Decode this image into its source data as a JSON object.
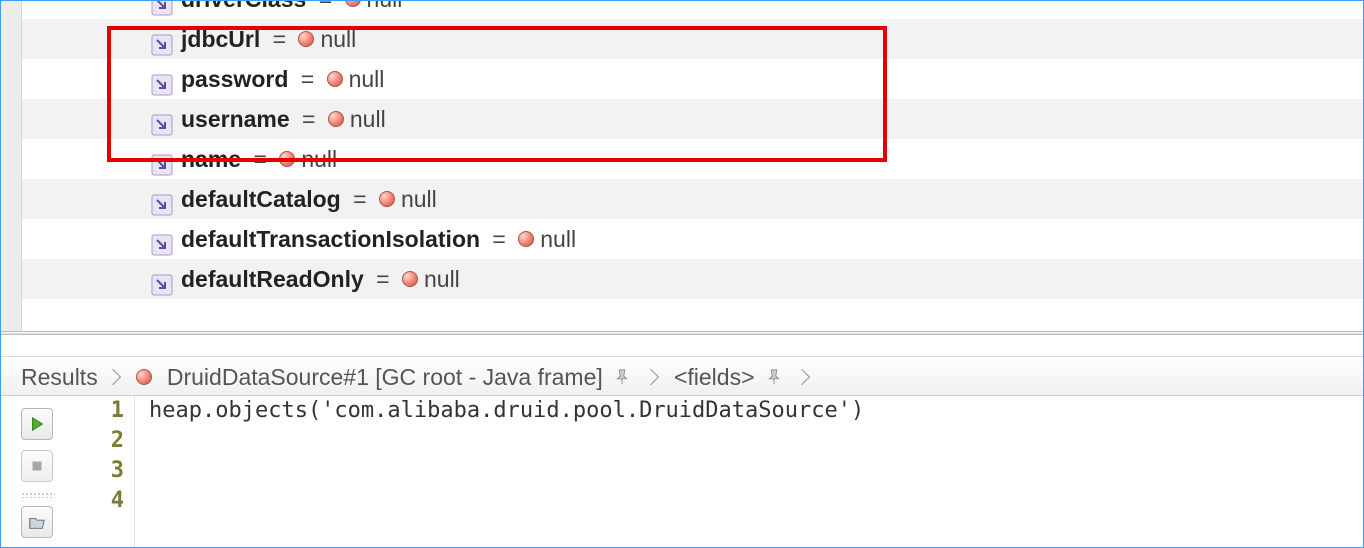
{
  "fields": [
    {
      "name": "driverClass",
      "value": "null",
      "alt": false
    },
    {
      "name": "jdbcUrl",
      "value": "null",
      "alt": true
    },
    {
      "name": "password",
      "value": "null",
      "alt": false
    },
    {
      "name": "username",
      "value": "null",
      "alt": true
    },
    {
      "name": "name",
      "value": "null",
      "alt": false
    },
    {
      "name": "defaultCatalog",
      "value": "null",
      "alt": true
    },
    {
      "name": "defaultTransactionIsolation",
      "value": "null",
      "alt": false
    },
    {
      "name": "defaultReadOnly",
      "value": "null",
      "alt": true
    }
  ],
  "highlightedFields": [
    "jdbcUrl",
    "password",
    "username"
  ],
  "breadcrumb": {
    "root": "Results",
    "object": "DruidDataSource#1 [GC root - Java frame]",
    "tail": "<fields>"
  },
  "editor": {
    "lines": [
      "heap.objects('com.alibaba.druid.pool.DruidDataSource')",
      "",
      "",
      ""
    ]
  }
}
